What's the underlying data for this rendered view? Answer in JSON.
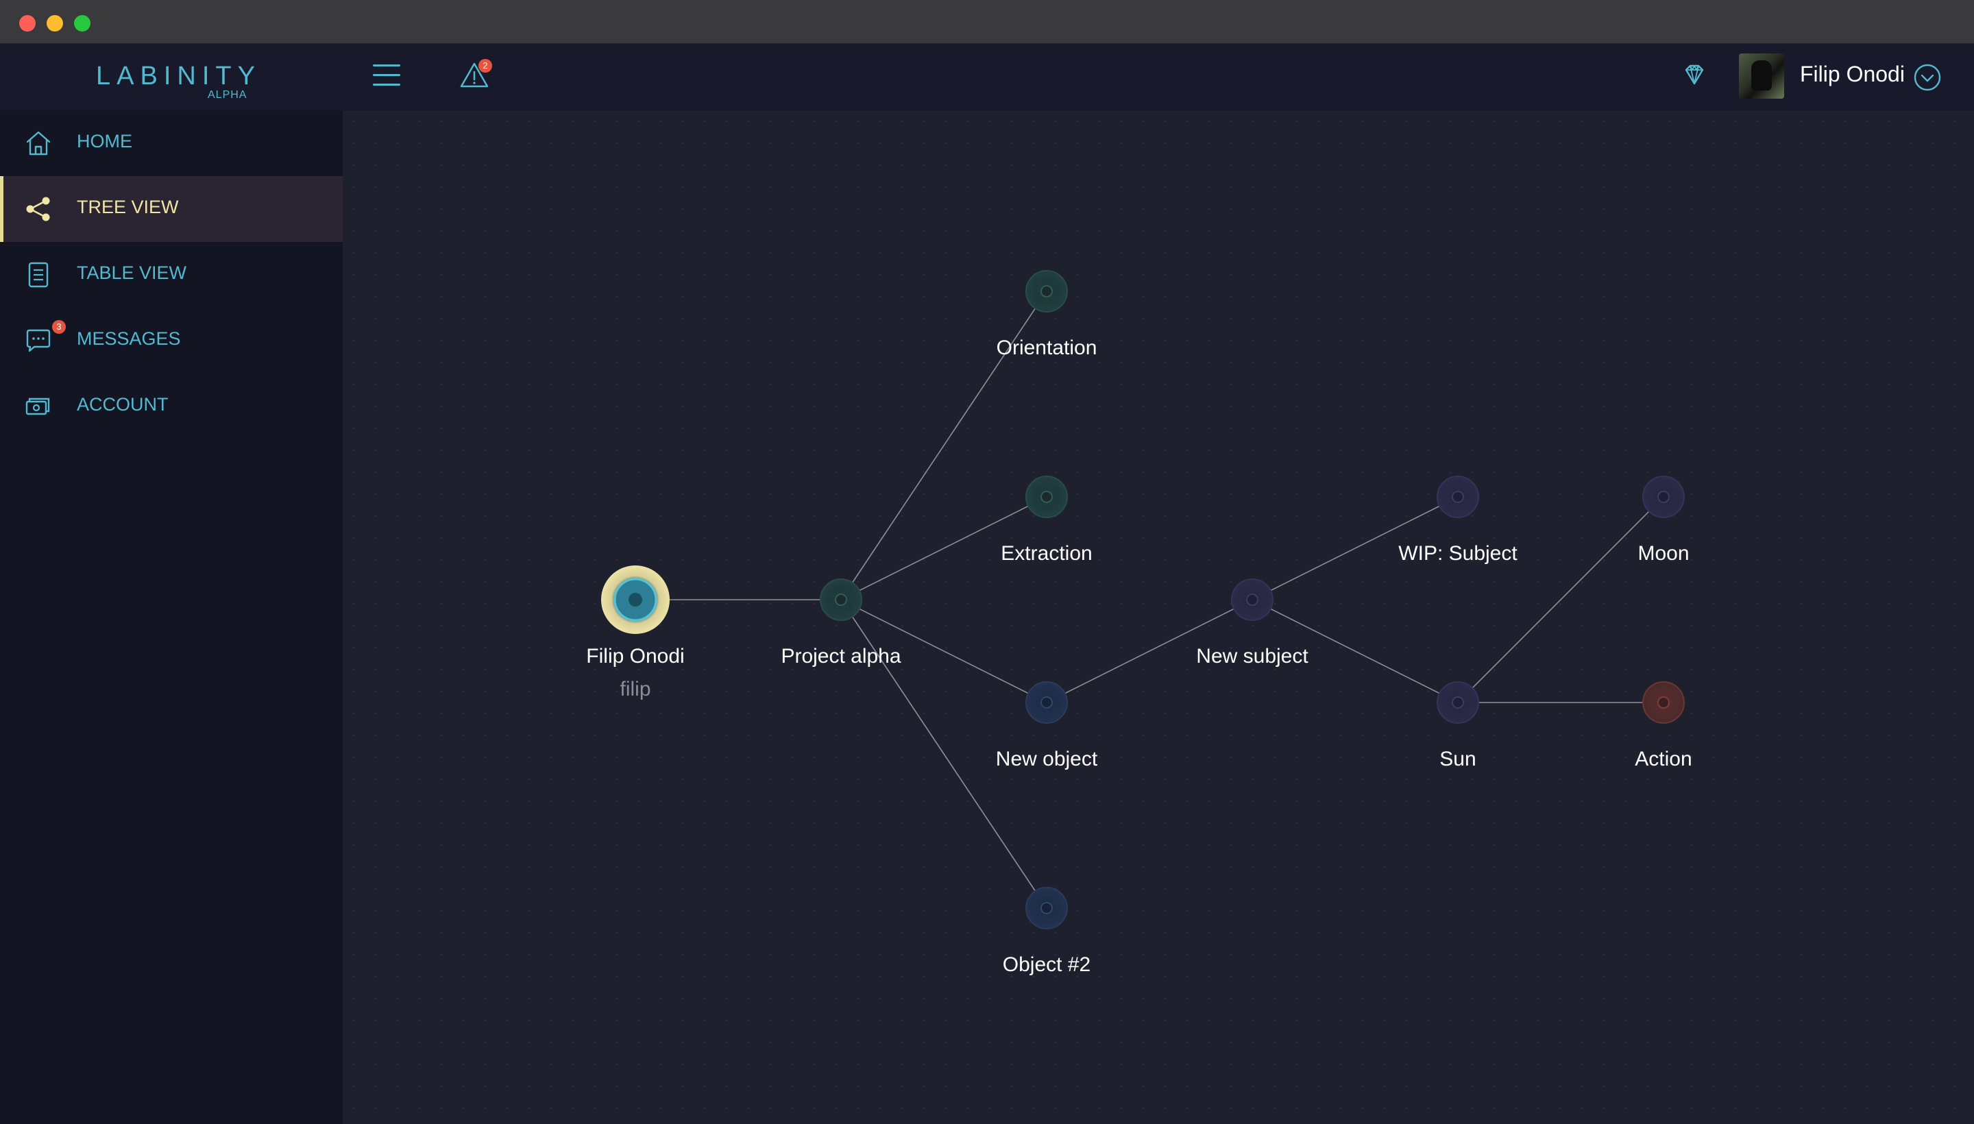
{
  "app": {
    "logo": "LABINITY",
    "logo_sub": "ALPHA"
  },
  "header": {
    "alert_count": "2",
    "user_name": "Filip Onodi",
    "icons": [
      "menu-icon",
      "alert-icon",
      "diamond-icon",
      "chevron-down-icon"
    ]
  },
  "sidebar": {
    "items": [
      {
        "label": "HOME",
        "icon": "home-icon"
      },
      {
        "label": "TREE VIEW",
        "icon": "share-icon",
        "active": true
      },
      {
        "label": "TABLE VIEW",
        "icon": "document-icon"
      },
      {
        "label": "MESSAGES",
        "icon": "chat-icon",
        "badge": "3"
      },
      {
        "label": "ACCOUNT",
        "icon": "wallet-icon"
      }
    ]
  },
  "tree": {
    "nodes": [
      {
        "id": "root",
        "label": "Filip Onodi",
        "sub": "filip",
        "kind": "root"
      },
      {
        "id": "project",
        "label": "Project alpha",
        "kind": "teal"
      },
      {
        "id": "orientation",
        "label": "Orientation",
        "kind": "teal"
      },
      {
        "id": "extraction",
        "label": "Extraction",
        "kind": "teal"
      },
      {
        "id": "newobject",
        "label": "New object",
        "kind": "blue"
      },
      {
        "id": "object2",
        "label": "Object #2",
        "kind": "blue"
      },
      {
        "id": "newsubject",
        "label": "New subject",
        "kind": "purple"
      },
      {
        "id": "wip",
        "label": "WIP: Subject",
        "kind": "purple"
      },
      {
        "id": "sun",
        "label": "Sun",
        "kind": "purple"
      },
      {
        "id": "moon",
        "label": "Moon",
        "kind": "purple"
      },
      {
        "id": "action",
        "label": "Action",
        "kind": "red"
      }
    ],
    "edges": [
      [
        "root",
        "project"
      ],
      [
        "project",
        "orientation"
      ],
      [
        "project",
        "extraction"
      ],
      [
        "project",
        "newobject"
      ],
      [
        "project",
        "object2"
      ],
      [
        "newobject",
        "newsubject"
      ],
      [
        "newsubject",
        "wip"
      ],
      [
        "newsubject",
        "sun"
      ],
      [
        "sun",
        "moon"
      ],
      [
        "sun",
        "action"
      ]
    ]
  }
}
